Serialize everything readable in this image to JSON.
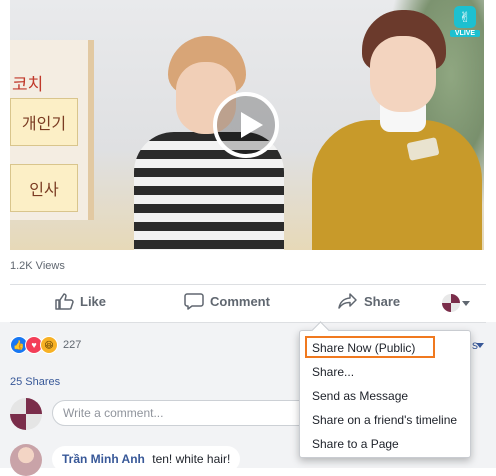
{
  "video": {
    "board_signs": [
      "코치",
      "개인기",
      "인사"
    ],
    "logo_text": "VLIVE"
  },
  "views": "1.2K Views",
  "actions": {
    "like": "Like",
    "comment": "Comment",
    "share": "Share"
  },
  "reactions": {
    "count": "227"
  },
  "cut_off_text": "s",
  "shares": "25 Shares",
  "comment_box": {
    "placeholder": "Write a comment..."
  },
  "comment": {
    "author": "Trần Minh Anh",
    "text": "ten! white hair!"
  },
  "share_menu": {
    "items": [
      "Share Now (Public)",
      "Share...",
      "Send as Message",
      "Share on a friend's timeline",
      "Share to a Page"
    ]
  },
  "colors": {
    "link": "#385898",
    "highlight": "#f0791f",
    "like_blue": "#1877f2"
  }
}
